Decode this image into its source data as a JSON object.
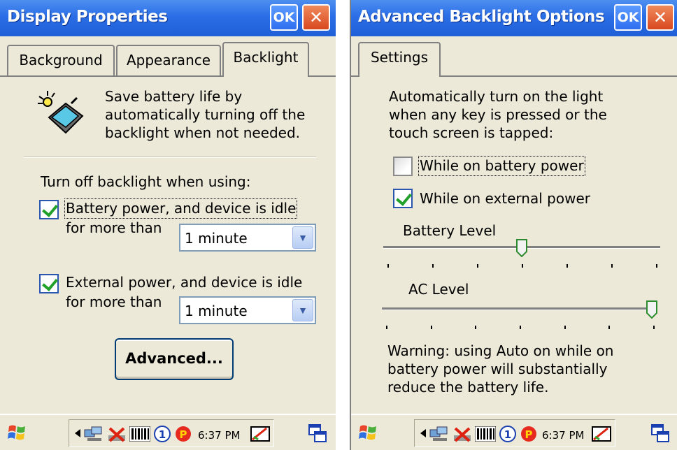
{
  "left": {
    "title": "Display Properties",
    "ok_label": "OK",
    "close_label": "✕",
    "tabs": [
      "Background",
      "Appearance",
      "Backlight"
    ],
    "active_tab": "Backlight",
    "description": [
      "Save battery life by",
      "automatically turning off the",
      "backlight when not needed."
    ],
    "turn_off_label": "Turn off backlight when using:",
    "battery_checkbox_label": "Battery power, and device is idle",
    "battery_checked": true,
    "battery_for_more_than": "for more than",
    "battery_timeout": "1 minute",
    "external_checkbox_label": "External power, and device is idle",
    "external_checked": true,
    "external_for_more_than": "for more than",
    "external_timeout": "1 minute",
    "advanced_button": "Advanced..."
  },
  "right": {
    "title": "Advanced Backlight Options",
    "ok_label": "OK",
    "close_label": "✕",
    "tabs": [
      "Settings"
    ],
    "description": [
      "Automatically turn on the light",
      "when any key is pressed or the",
      "touch screen is tapped:"
    ],
    "on_battery_label": "While on battery power",
    "on_battery_checked": false,
    "on_external_label": "While on external power",
    "on_external_checked": true,
    "battery_level_label": "Battery Level",
    "battery_level_value": 0.5,
    "ac_level_label": "AC Level",
    "ac_level_value": 1.0,
    "warning": [
      "Warning: using Auto on while on",
      "battery power will substantially",
      "reduce the battery life."
    ]
  },
  "taskbar": {
    "time": "6:37 PM",
    "icons": [
      "windows-flag-icon",
      "arrow-left-icon",
      "network-icon",
      "battery-no-charge-icon",
      "barcode-icon",
      "number-one-icon",
      "p-icon",
      "input-panel-icon",
      "window-switch-icon"
    ]
  },
  "colors": {
    "title_bar": "#2a6ee6",
    "dialog_bg": "#ece9d8",
    "check_green": "#22a12a",
    "close_red": "#d9481f"
  }
}
